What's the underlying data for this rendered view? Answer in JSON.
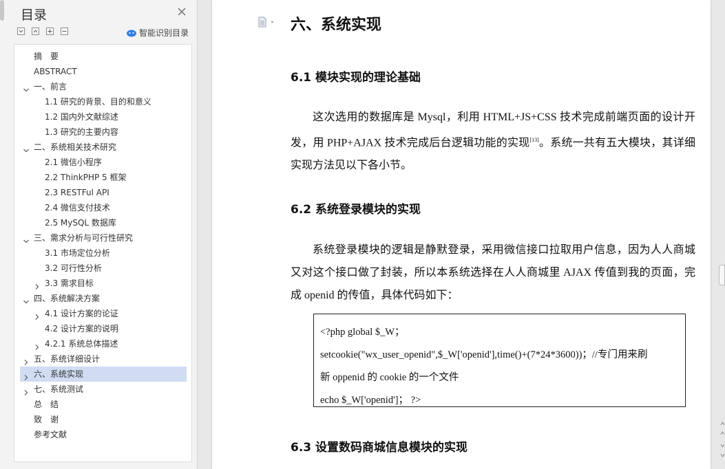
{
  "toc": {
    "title": "目录",
    "smart_label": "智能识别目录",
    "items": [
      {
        "label": "摘　要",
        "level": 0,
        "expandable": false,
        "expanded": false,
        "selected": false
      },
      {
        "label": "ABSTRACT",
        "level": 0,
        "expandable": false,
        "expanded": false,
        "selected": false
      },
      {
        "label": "一、前言",
        "level": 0,
        "expandable": true,
        "expanded": true,
        "selected": false
      },
      {
        "label": "1.1  研究的背景、目的和意义",
        "level": 1,
        "expandable": false,
        "expanded": false,
        "selected": false
      },
      {
        "label": "1.2  国内外文献综述",
        "level": 1,
        "expandable": false,
        "expanded": false,
        "selected": false
      },
      {
        "label": "1.3  研究的主要内容",
        "level": 1,
        "expandable": false,
        "expanded": false,
        "selected": false
      },
      {
        "label": "二、系统相关技术研究",
        "level": 0,
        "expandable": true,
        "expanded": true,
        "selected": false
      },
      {
        "label": "2.1  微信小程序",
        "level": 1,
        "expandable": false,
        "expanded": false,
        "selected": false
      },
      {
        "label": "2.2 ThinkPHP 5  框架",
        "level": 1,
        "expandable": false,
        "expanded": false,
        "selected": false
      },
      {
        "label": "2.3 RESTFul API",
        "level": 1,
        "expandable": false,
        "expanded": false,
        "selected": false
      },
      {
        "label": "2.4  微信支付技术",
        "level": 1,
        "expandable": false,
        "expanded": false,
        "selected": false
      },
      {
        "label": "2.5 MySQL 数据库",
        "level": 1,
        "expandable": false,
        "expanded": false,
        "selected": false
      },
      {
        "label": "三、需求分析与可行性研究",
        "level": 0,
        "expandable": true,
        "expanded": true,
        "selected": false
      },
      {
        "label": "3.1  市场定位分析",
        "level": 1,
        "expandable": false,
        "expanded": false,
        "selected": false
      },
      {
        "label": "3.2  可行性分析",
        "level": 1,
        "expandable": false,
        "expanded": false,
        "selected": false
      },
      {
        "label": "3.3  需求目标",
        "level": 1,
        "expandable": true,
        "expanded": false,
        "selected": false
      },
      {
        "label": "四、系统解决方案",
        "level": 0,
        "expandable": true,
        "expanded": true,
        "selected": false
      },
      {
        "label": "4.1  设计方案的论证",
        "level": 1,
        "expandable": true,
        "expanded": false,
        "selected": false
      },
      {
        "label": "4.2  设计方案的说明",
        "level": 1,
        "expandable": false,
        "expanded": false,
        "selected": false
      },
      {
        "label": "4.2.1  系统总体描述",
        "level": 1,
        "expandable": true,
        "expanded": false,
        "selected": false
      },
      {
        "label": "五、系统详细设计",
        "level": 0,
        "expandable": true,
        "expanded": false,
        "selected": false
      },
      {
        "label": "六、系统实现",
        "level": 0,
        "expandable": true,
        "expanded": false,
        "selected": true
      },
      {
        "label": "七、系统测试",
        "level": 0,
        "expandable": true,
        "expanded": false,
        "selected": false
      },
      {
        "label": "总　结",
        "level": 0,
        "expandable": false,
        "expanded": false,
        "selected": false
      },
      {
        "label": "致　谢",
        "level": 0,
        "expandable": false,
        "expanded": false,
        "selected": false
      },
      {
        "label": "参考文献",
        "level": 0,
        "expandable": false,
        "expanded": false,
        "selected": false
      }
    ]
  },
  "doc": {
    "chapter_title": "六、系统实现",
    "s61_title": "6.1  模块实现的理论基础",
    "s61_para_a": "这次选用的数据库是 Mysql，利用 HTML+JS+CSS 技术完成前端页面的设计开发，用 PHP+AJAX 技术完成后台逻辑功能的实现",
    "s61_cite": "[13]",
    "s61_para_b": "。系统一共有五大模块，其详细实现方法见以下各小节。",
    "s62_title": "6.2  系统登录模块的实现",
    "s62_para": "系统登录模块的逻辑是静默登录，采用微信接口拉取用户信息，因为人人商城又对这个接口做了封装，所以本系统选择在人人商城里 AJAX 传值到我的页面，完成 openid 的传值，具体代码如下：",
    "code_lines": [
      "<?php    global $_W；",
      "setcookie(\"wx_user_openid\",$_W['openid'],time()+(7*24*3600))；//专门用来刷",
      "新 oppenid 的 cookie 的一个文件",
      "echo $_W['openid']；    ?>"
    ],
    "s63_title": "6.3  设置数码商城信息模块的实现"
  },
  "colors": {
    "selected_bg": "#cfdcf1",
    "panel_bg": "#f3f3f3",
    "page_bg": "#ffffff",
    "accent": "#2f7de1"
  }
}
